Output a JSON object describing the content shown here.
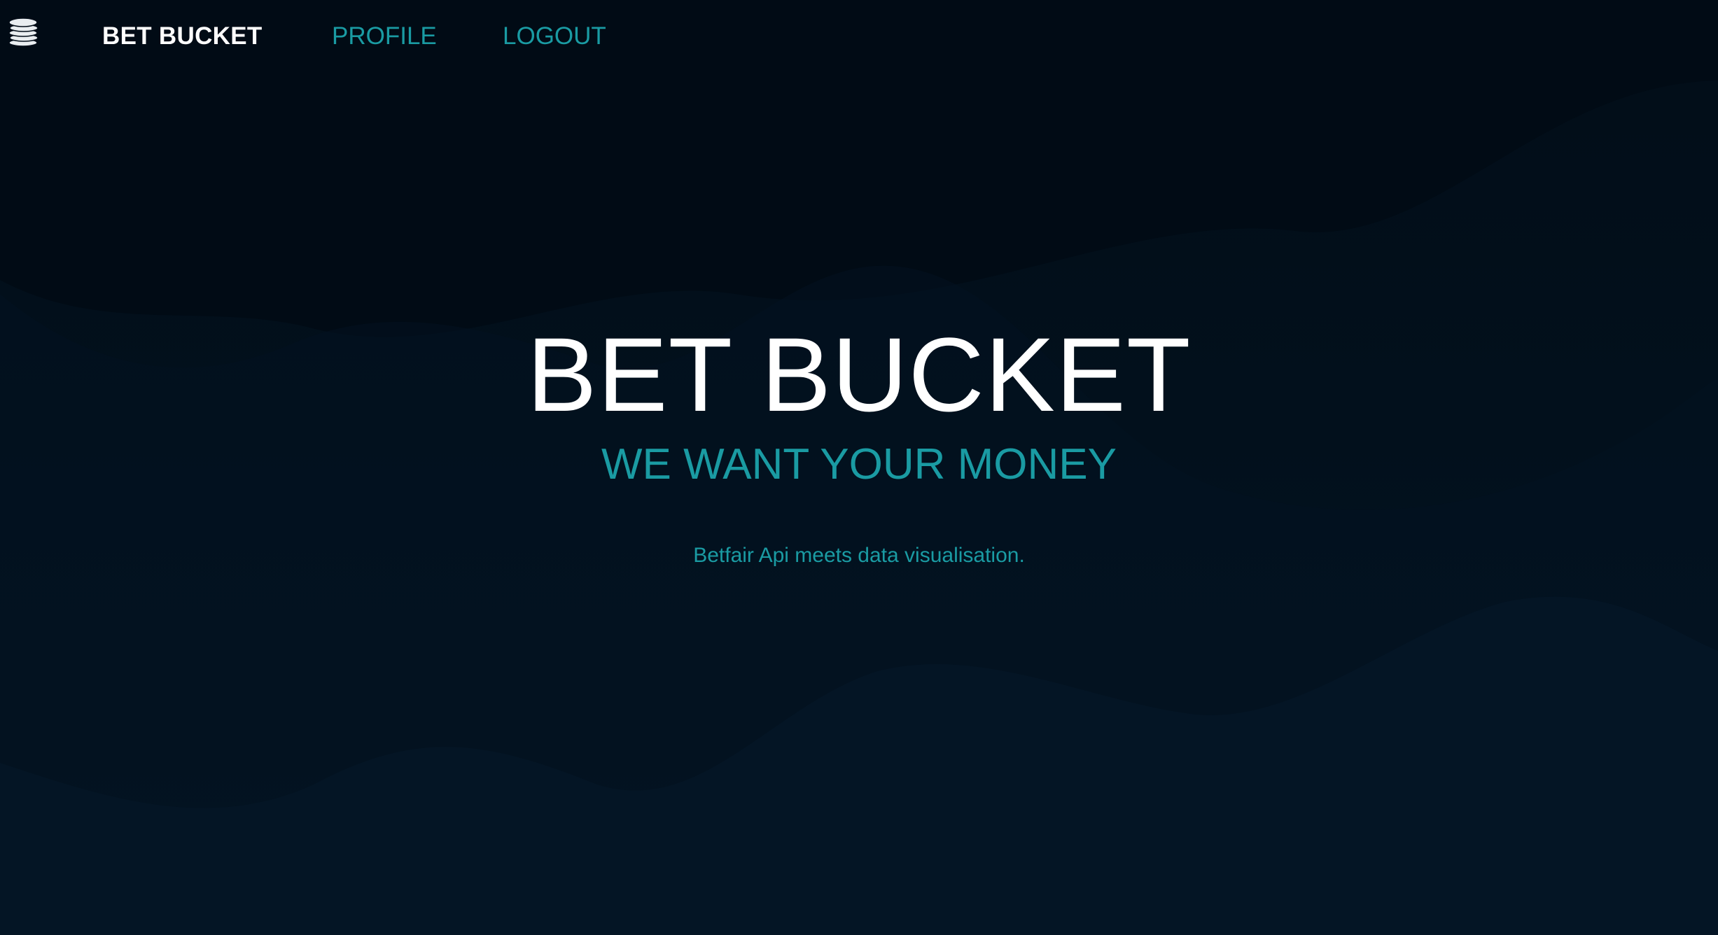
{
  "colors": {
    "background": "#020f1b",
    "accent": "#1a9ba3",
    "text": "#ffffff"
  },
  "navbar": {
    "logo_icon": "coin-stack-icon",
    "brand": "BET BUCKET",
    "links": [
      {
        "label": "PROFILE"
      },
      {
        "label": "LOGOUT"
      }
    ]
  },
  "hero": {
    "title": "BET BUCKET",
    "subtitle": "WE WANT YOUR MONEY",
    "tagline": "Betfair Api meets data visualisation."
  }
}
